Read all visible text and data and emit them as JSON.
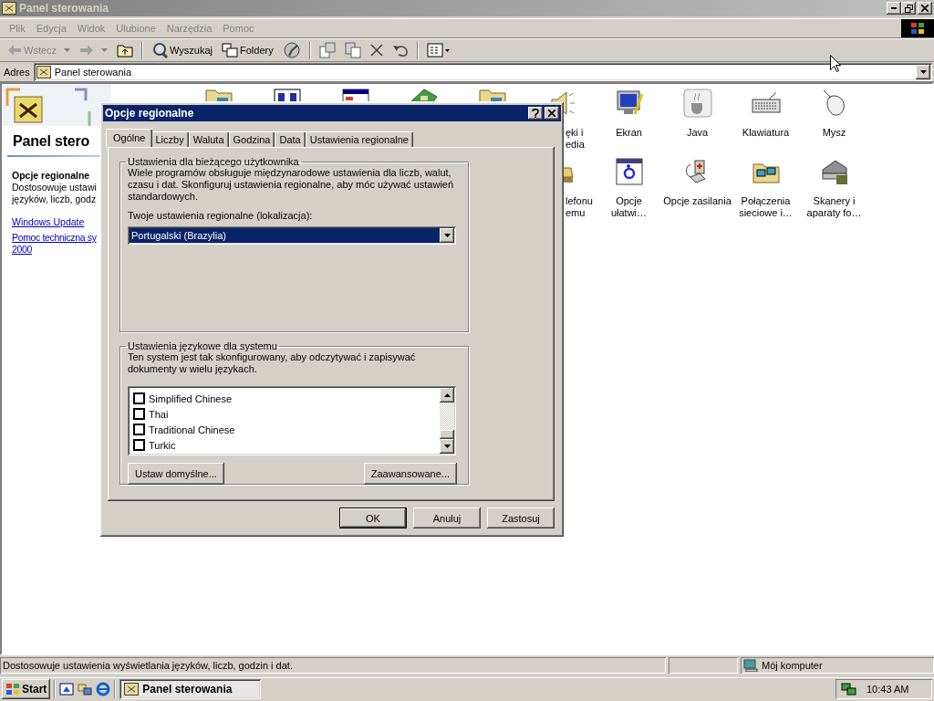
{
  "window": {
    "title": "Panel sterowania"
  },
  "menu": [
    "Plik",
    "Edycja",
    "Widok",
    "Ulubione",
    "Narzędzia",
    "Pomoc"
  ],
  "toolbar": [
    {
      "kind": "back",
      "label": "Wstecz",
      "disabled": true
    },
    {
      "kind": "forward",
      "disabled": true
    },
    {
      "kind": "up"
    },
    {
      "kind": "sep"
    },
    {
      "kind": "search",
      "label": "Wyszukaj"
    },
    {
      "kind": "folders",
      "label": "Foldery"
    },
    {
      "kind": "history"
    },
    {
      "kind": "sep"
    },
    {
      "kind": "move"
    },
    {
      "kind": "copy"
    },
    {
      "kind": "delete"
    },
    {
      "kind": "undo"
    },
    {
      "kind": "sep"
    },
    {
      "kind": "views"
    }
  ],
  "address": {
    "label": "Adres",
    "value": "Panel sterowania"
  },
  "left_pane": {
    "heading": "Panel stero",
    "title": "Opcje regionalne",
    "description": [
      "Dostosowuje ustawi",
      "języków, liczb, godz"
    ],
    "links": [
      {
        "lines": [
          "Windows Update"
        ]
      },
      {
        "lines": [
          "Pomoc techniczna sy",
          "2000"
        ]
      }
    ]
  },
  "icon_rows": [
    [
      {
        "kind": "covered"
      },
      {
        "kind": "covered"
      },
      {
        "kind": "covered"
      },
      {
        "kind": "covered"
      },
      {
        "kind": "covered"
      },
      {
        "kind": "partial",
        "lines": [
          "ęki i",
          "edia"
        ]
      },
      {
        "kind": "full",
        "lines": [
          "Ekran"
        ]
      },
      {
        "kind": "full",
        "lines": [
          "Java"
        ]
      },
      {
        "kind": "full",
        "lines": [
          "Klawiatura"
        ]
      },
      {
        "kind": "full",
        "lines": [
          "Mysz"
        ]
      }
    ],
    [
      {
        "kind": "partial",
        "lines": [
          "lefonu",
          "emu"
        ]
      },
      {
        "kind": "full",
        "lines": [
          "Opcje",
          "ułatwi…"
        ]
      },
      {
        "kind": "full",
        "lines": [
          "Opcje zasilania"
        ]
      },
      {
        "kind": "full",
        "lines": [
          "Połączenia",
          "sieciowe i…"
        ]
      },
      {
        "kind": "full",
        "lines": [
          "Skanery i",
          "aparaty fo…"
        ]
      }
    ]
  ],
  "dialog": {
    "title": "Opcje regionalne",
    "tabs": [
      {
        "label": "Ogólne",
        "selected": true
      },
      {
        "label": "Liczby",
        "selected": false
      },
      {
        "label": "Waluta",
        "selected": false
      },
      {
        "label": "Godzina",
        "selected": false
      },
      {
        "label": "Data",
        "selected": false
      },
      {
        "label": "Ustawienia regionalne",
        "selected": false
      }
    ],
    "user_group": {
      "legend": "Ustawienia dla bieżącego użytkownika",
      "text": "Wiele programów obsługuje międzynarodowe ustawienia dla liczb, walut, czasu i dat. Skonfiguruj ustawienia regionalne, aby móc używać ustawień standardowych.",
      "locale_label": "Twoje ustawienia regionalne (lokalizacja):",
      "locale_value": "Portugalski (Brazylia)"
    },
    "system_group": {
      "legend": "Ustawienia językowe dla systemu",
      "text": "Ten system jest tak skonfigurowany, aby odczytywać i zapisywać dokumenty w wielu językach.",
      "languages": [
        {
          "label": "Simplified Chinese",
          "checked": false
        },
        {
          "label": "Thai",
          "checked": false
        },
        {
          "label": "Traditional Chinese",
          "checked": false
        },
        {
          "label": "Turkic",
          "checked": false
        }
      ],
      "buttons": [
        "Ustaw domyślne...",
        "Zaawansowane..."
      ]
    },
    "buttons": [
      {
        "label": "OK",
        "default": true
      },
      {
        "label": "Anuluj",
        "default": false
      },
      {
        "label": "Zastosuj",
        "default": false
      }
    ]
  },
  "status_bar": {
    "text": "Dostosowuje ustawienia wyświetlania języków, liczb, godzin i dat.",
    "zone": "Mój komputer"
  },
  "taskbar": {
    "start": "Start",
    "task": "Panel sterowania",
    "time": "10:43 AM"
  }
}
